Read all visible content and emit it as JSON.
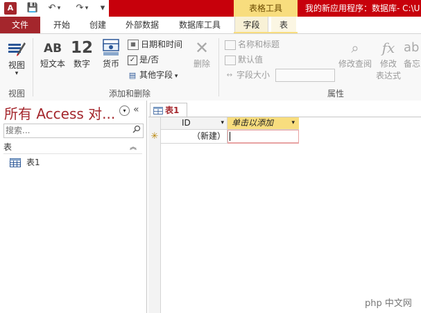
{
  "window": {
    "context_tab_label": "表格工具",
    "app_title": "我的新应用程序：数据库- C:\\U"
  },
  "qat": {
    "app_icon": "A",
    "save": "💾",
    "undo": "↶",
    "redo": "↷",
    "customize": "▾"
  },
  "tabs": [
    "文件",
    "开始",
    "创建",
    "外部数据",
    "数据库工具",
    "字段",
    "表"
  ],
  "ribbon": {
    "view_group": {
      "view_label": "视图",
      "group_label": "视图"
    },
    "add_delete_group": {
      "short_text_icon": "AB",
      "short_text_label": "短文本",
      "number_icon": "12",
      "number_label": "数字",
      "currency_label": "货币",
      "datetime_label": "日期和时间",
      "yesno_label": "是/否",
      "more_fields_label": "其他字段",
      "delete_label": "删除",
      "group_label": "添加和删除"
    },
    "properties_group": {
      "name_caption_label": "名称和标题",
      "default_value_label": "默认值",
      "field_size_label": "字段大小",
      "field_size_value": "",
      "modify_lookups_label": "修改查阅",
      "modify_expression_label1": "修改",
      "modify_expression_label2": "表达式",
      "memo_label": "备忘",
      "group_label": "属性"
    }
  },
  "nav_pane": {
    "title": "所有 Access 对...",
    "search_placeholder": "搜索...",
    "group_label": "表",
    "items": [
      {
        "label": "表1"
      }
    ]
  },
  "document": {
    "tab_label": "表1",
    "columns": [
      "ID",
      "单击以添加"
    ],
    "new_row": {
      "marker": "✳",
      "id_text": "（新建）",
      "add_value": ""
    }
  },
  "watermark": {
    "text": "php 中文网"
  },
  "colors": {
    "accent": "#a4262c",
    "title_red": "#c7000b",
    "context_yellow": "#f8dd7e"
  }
}
